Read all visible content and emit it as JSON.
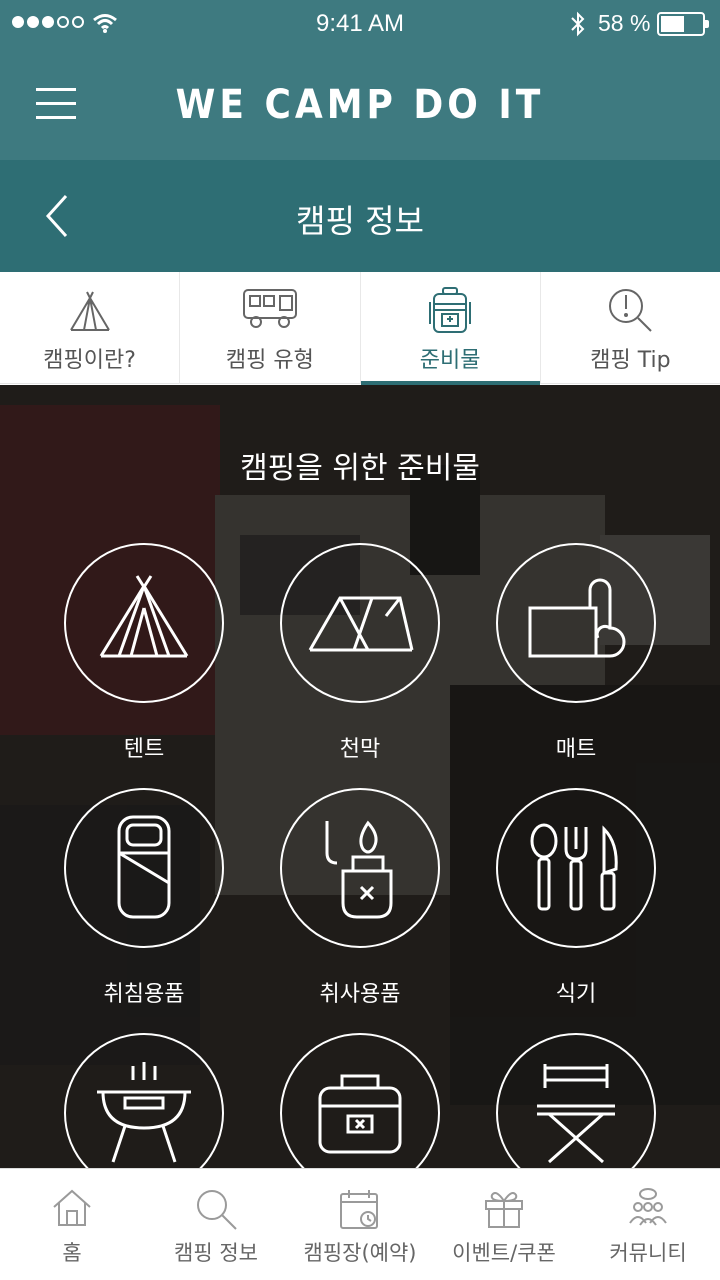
{
  "status_bar": {
    "time": "9:41 AM",
    "battery_percent": "58 %",
    "battery_level": 0.58,
    "signal_bars_filled": 3,
    "signal_bars_total": 5
  },
  "app_bar": {
    "title": "WE CAMP DO IT",
    "menu_icon": "hamburger-icon"
  },
  "sub_header": {
    "title": "캠핑 정보",
    "back_icon": "chevron-left-icon"
  },
  "tabs": [
    {
      "label": "캠핑이란?",
      "icon": "teepee-icon",
      "active": false
    },
    {
      "label": "캠핑 유형",
      "icon": "camper-van-icon",
      "active": false
    },
    {
      "label": "준비물",
      "icon": "backpack-icon",
      "active": true
    },
    {
      "label": "캠핑 Tip",
      "icon": "tip-magnifier-icon",
      "active": false
    }
  ],
  "hero": {
    "title": "캠핑을 위한 준비물",
    "items": [
      {
        "label": "텐트",
        "icon": "tent-icon"
      },
      {
        "label": "천막",
        "icon": "canopy-icon"
      },
      {
        "label": "매트",
        "icon": "mat-icon"
      },
      {
        "label": "취침용품",
        "icon": "sleeping-bag-icon"
      },
      {
        "label": "취사용품",
        "icon": "lighter-icon"
      },
      {
        "label": "식기",
        "icon": "cutlery-icon"
      },
      {
        "label": "",
        "icon": "grill-icon"
      },
      {
        "label": "",
        "icon": "cooler-icon"
      },
      {
        "label": "",
        "icon": "camp-chair-icon"
      }
    ]
  },
  "bottom_nav": [
    {
      "label": "홈",
      "icon": "home-icon"
    },
    {
      "label": "캠핑 정보",
      "icon": "search-icon"
    },
    {
      "label": "캠핑장(예약)",
      "icon": "calendar-icon"
    },
    {
      "label": "이벤트/쿠폰",
      "icon": "gift-icon"
    },
    {
      "label": "커뮤니티",
      "icon": "community-icon"
    }
  ],
  "colors": {
    "brand": "#3e7a80",
    "brand_dark": "#2e6e74",
    "active_tab": "#2e6e74",
    "nav_icon": "#9a9a9a"
  }
}
